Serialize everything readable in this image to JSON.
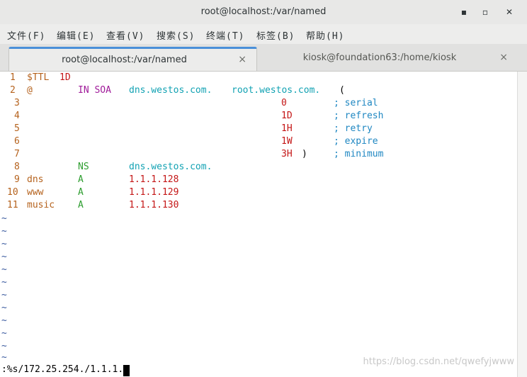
{
  "window": {
    "title": "root@localhost:/var/named",
    "min": "▪",
    "max": "▫",
    "close": "✕"
  },
  "menu": [
    "文件(F)",
    "编辑(E)",
    "查看(V)",
    "搜索(S)",
    "终端(T)",
    "标签(B)",
    "帮助(H)"
  ],
  "tabs": [
    {
      "label": "root@localhost:/var/named",
      "close": "×"
    },
    {
      "label": "kiosk@foundation63:/home/kiosk",
      "close": "×"
    }
  ],
  "lines": [
    {
      "n": "1",
      "a": "$TTL",
      "b": "1D"
    },
    {
      "n": "2",
      "a": "@",
      "b": "IN SOA",
      "c": "dns.westos.com.",
      "d": "root.westos.com.",
      "e": "("
    },
    {
      "n": "3",
      "v": "0",
      "k": "; serial"
    },
    {
      "n": "4",
      "v": "1D",
      "k": "; refresh"
    },
    {
      "n": "5",
      "v": "1H",
      "k": "; retry"
    },
    {
      "n": "6",
      "v": "1W",
      "k": "; expire"
    },
    {
      "n": "7",
      "v": "3H",
      "p": ")",
      "k": "; minimum"
    },
    {
      "n": "8",
      "t": "NS",
      "r": "dns.westos.com."
    },
    {
      "n": "9",
      "o": "dns",
      "t": "A",
      "r": "1.1.1.128"
    },
    {
      "n": "10",
      "o": "www",
      "t": "A",
      "r": "1.1.1.129"
    },
    {
      "n": "11",
      "o": "music",
      "t": "A",
      "r": "1.1.1.130"
    }
  ],
  "tilde": "~",
  "command": ":%s/172.25.254./1.1.1.",
  "watermark": "https://blog.csdn.net/qwefyjwww"
}
